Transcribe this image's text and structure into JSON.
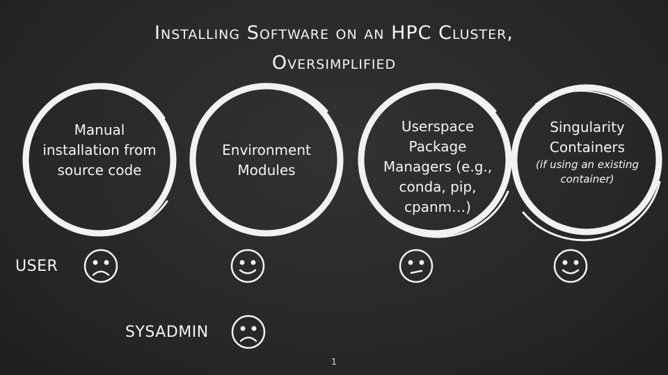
{
  "title": {
    "line1": "Installing Software on an HPC Cluster,",
    "line2": "Oversimplified"
  },
  "options": [
    {
      "label": "Manual installation from source code",
      "note": "",
      "user_face": "sad"
    },
    {
      "label": "Environment Modules",
      "note": "",
      "user_face": "happy"
    },
    {
      "label": "Userspace Package Managers (e.g., conda, pip, cpanm…)",
      "note": "",
      "user_face": "neutral"
    },
    {
      "label": "Singularity Containers",
      "note": "(if using an existing container)",
      "user_face": "happy"
    }
  ],
  "roles": {
    "user": "USER",
    "sysadmin": "SYSADMIN"
  },
  "sysadmin_face": "sad",
  "page_number": "1"
}
